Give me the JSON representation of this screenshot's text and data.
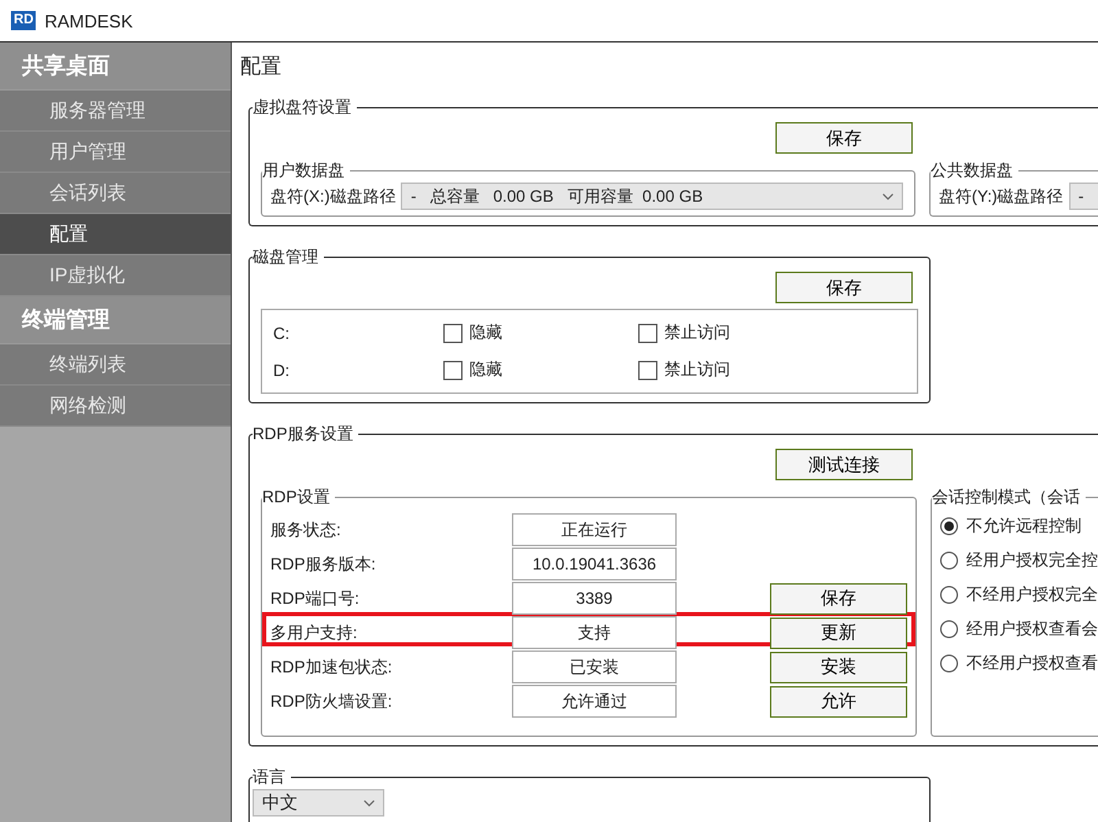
{
  "window": {
    "title": "RAMDESK",
    "logo": "RD"
  },
  "sidebar": {
    "sections": [
      {
        "title": "共享桌面",
        "items": [
          {
            "label": "服务器管理",
            "selected": false
          },
          {
            "label": "用户管理",
            "selected": false
          },
          {
            "label": "会话列表",
            "selected": false
          },
          {
            "label": "配置",
            "selected": true
          },
          {
            "label": "IP虚拟化",
            "selected": false
          }
        ]
      },
      {
        "title": "终端管理",
        "items": [
          {
            "label": "终端列表",
            "selected": false
          },
          {
            "label": "网络检测",
            "selected": false
          }
        ]
      }
    ]
  },
  "page_title": "配置",
  "virtual_disk": {
    "title": "虚拟盘符设置",
    "save_button": "保存",
    "user_disk": {
      "title": "用户数据盘",
      "label": "盘符(X:)磁盘路径",
      "value": "-   总容量   0.00 GB   可用容量  0.00 GB"
    },
    "public_disk": {
      "title": "公共数据盘",
      "label": "盘符(Y:)磁盘路径",
      "value": "-"
    }
  },
  "disk_management": {
    "title": "磁盘管理",
    "save_button": "保存",
    "drives": [
      {
        "name": "C:",
        "options": [
          {
            "label": "隐藏",
            "checked": false
          },
          {
            "label": "禁止访问",
            "checked": false
          }
        ]
      },
      {
        "name": "D:",
        "options": [
          {
            "label": "隐藏",
            "checked": false
          },
          {
            "label": "禁止访问",
            "checked": false
          }
        ]
      }
    ]
  },
  "rdp": {
    "title": "RDP服务设置",
    "test_button": "测试连接",
    "settings": {
      "title": "RDP设置",
      "rows": [
        {
          "label": "服务状态:",
          "value": "正在运行",
          "highlighted": false
        },
        {
          "label": "RDP服务版本:",
          "value": "10.0.19041.3636",
          "highlighted": false
        },
        {
          "label": "RDP端口号:",
          "value": "3389",
          "button": "保存",
          "highlighted": false
        },
        {
          "label": "多用户支持:",
          "value": "支持",
          "button": "更新",
          "highlighted": true
        },
        {
          "label": "RDP加速包状态:",
          "value": "已安装",
          "button": "安装",
          "highlighted": false
        },
        {
          "label": "RDP防火墙设置:",
          "value": "允许通过",
          "button": "允许",
          "highlighted": false
        }
      ]
    },
    "session_control": {
      "title": "会话控制模式（会话",
      "options": [
        {
          "label": "不允许远程控制",
          "selected": true
        },
        {
          "label": "经用户授权完全控",
          "selected": false
        },
        {
          "label": "不经用户授权完全",
          "selected": false
        },
        {
          "label": "经用户授权查看会",
          "selected": false
        },
        {
          "label": "不经用户授权查看",
          "selected": false
        }
      ]
    }
  },
  "language": {
    "title": "语言",
    "value": "中文"
  }
}
